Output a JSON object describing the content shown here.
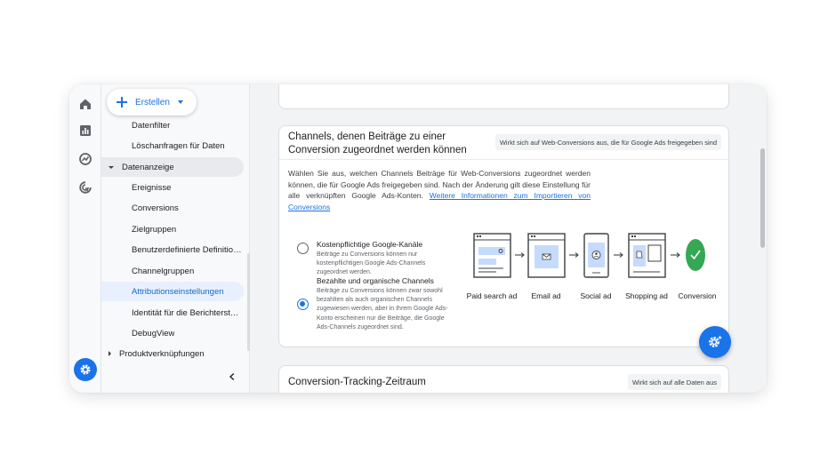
{
  "rail": {
    "icons": [
      "home-icon",
      "reports-icon",
      "explore-icon",
      "advertising-icon"
    ],
    "admin_icon": "gear-icon",
    "accent": "#1a73e8"
  },
  "nav": {
    "create_label": "Erstellen",
    "items": [
      {
        "label": "Datenfilter",
        "kind": "child"
      },
      {
        "label": "Löschanfragen für Daten",
        "kind": "child"
      },
      {
        "label": "Datenanzeige",
        "kind": "parent-expanded"
      },
      {
        "label": "Ereignisse",
        "kind": "child"
      },
      {
        "label": "Conversions",
        "kind": "child"
      },
      {
        "label": "Zielgruppen",
        "kind": "child"
      },
      {
        "label": "Benutzerdefinierte Definitionen",
        "kind": "child"
      },
      {
        "label": "Channelgruppen",
        "kind": "child"
      },
      {
        "label": "Attributionseinstellungen",
        "kind": "child-active"
      },
      {
        "label": "Identität für die Berichterstellung",
        "kind": "child"
      },
      {
        "label": "DebugView",
        "kind": "child"
      },
      {
        "label": "Produktverknüpfungen",
        "kind": "parent-collapsed"
      }
    ]
  },
  "channels_card": {
    "title": "Channels, denen Beiträge zu einer Conversion zugeordnet werden können",
    "chip": "Wirkt sich auf Web-Conversions aus, die für Google Ads freigegeben sind",
    "description": "Wählen Sie aus, welchen Channels Beiträge für Web-Conversions zugeordnet werden können, die für Google Ads freigegeben sind. Nach der Änderung gilt diese Einstellung für alle verknüpften Google Ads-Konten.",
    "link": "Weitere Informationen zum Importieren von Conversions",
    "options": [
      {
        "title": "Kostenpflichtige Google-Kanäle",
        "desc": "Beiträge zu Conversions können nur kostenpflichtigen Google Ads-Channels zugeordnet werden.",
        "checked": false
      },
      {
        "title": "Bezahlte und organische Channels",
        "desc": "Beiträge zu Conversions können zwar sowohl bezahlten als auch organischen Channels zugewiesen werden, aber in Ihrem Google Ads-Konto erscheinen nur die Beiträge, die Google Ads-Channels zugeordnet sind.",
        "checked": true
      }
    ],
    "flow_labels": [
      "Paid search ad",
      "Email ad",
      "Social ad",
      "Shopping ad",
      "Conversion"
    ],
    "conversion_color": "#34a853"
  },
  "period_card": {
    "title": "Conversion-Tracking-Zeitraum",
    "chip": "Wirkt sich auf alle Daten aus"
  }
}
